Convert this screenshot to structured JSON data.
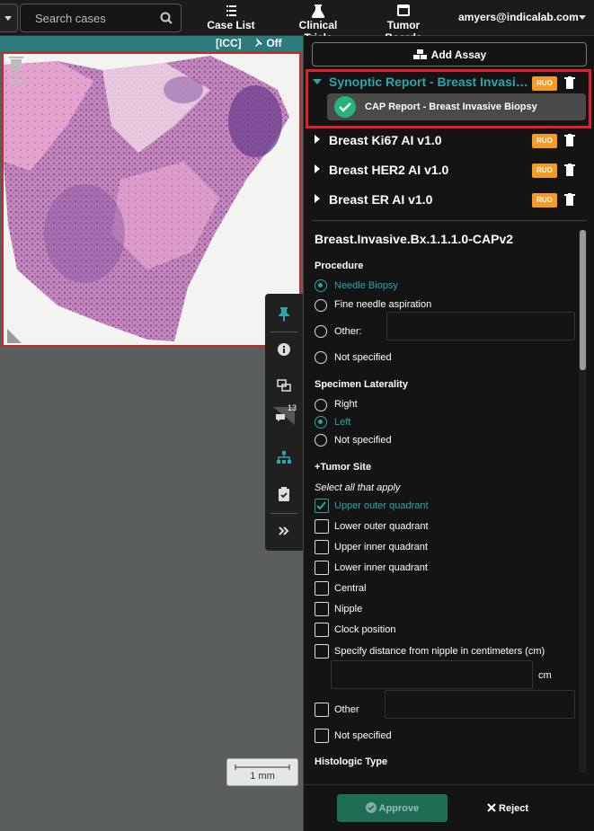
{
  "search": {
    "placeholder": "Search cases"
  },
  "nav": [
    {
      "label": "Case List",
      "icon": "list-icon"
    },
    {
      "label": "Clinical Trials",
      "icon": "flask-icon"
    },
    {
      "label": "Tumor Boards",
      "icon": "board-icon"
    }
  ],
  "user": {
    "email": "amyers@indicalab.com"
  },
  "viewer": {
    "icc": "[ICC]",
    "pin_state": "Off",
    "scale": "1 mm",
    "annotation_count": "13"
  },
  "panel": {
    "add_assay": "Add Assay",
    "expanded_report": {
      "title": "Synoptic Report - Breast Invasive Biopsy",
      "badge": "RUO",
      "child": "CAP Report - Breast Invasive Biopsy"
    },
    "assays": [
      {
        "title": "Breast Ki67 AI v1.0",
        "badge": "RUO"
      },
      {
        "title": "Breast HER2 AI v1.0",
        "badge": "RUO"
      },
      {
        "title": "Breast ER AI v1.0",
        "badge": "RUO"
      }
    ]
  },
  "form": {
    "title": "Breast.Invasive.Bx.1.1.1.0-CAPv2",
    "procedure": {
      "label": "Procedure",
      "options": [
        "Needle Biopsy",
        "Fine needle aspiration",
        "Other:",
        "Not specified"
      ],
      "selected": "Needle Biopsy"
    },
    "laterality": {
      "label": "Specimen Laterality",
      "options": [
        "Right",
        "Left",
        "Not specified"
      ],
      "selected": "Left"
    },
    "tumor_site": {
      "label": "+Tumor Site",
      "hint": "Select all that apply",
      "options": [
        "Upper outer quadrant",
        "Lower outer quadrant",
        "Upper inner quadrant",
        "Lower inner quadrant",
        "Central",
        "Nipple",
        "Clock position",
        "Specify distance from nipple in centimeters (cm)"
      ],
      "checked": [
        "Upper outer quadrant"
      ],
      "unit": "cm",
      "other": "Other",
      "not_specified": "Not specified"
    },
    "histologic": {
      "label": "Histologic Type"
    }
  },
  "footer": {
    "approve": "Approve",
    "reject": "Reject"
  },
  "colors": {
    "accent": "#2ca6a6",
    "highlight": "#e0202a",
    "badge": "#f59a23",
    "approve": "#1e6e53"
  }
}
